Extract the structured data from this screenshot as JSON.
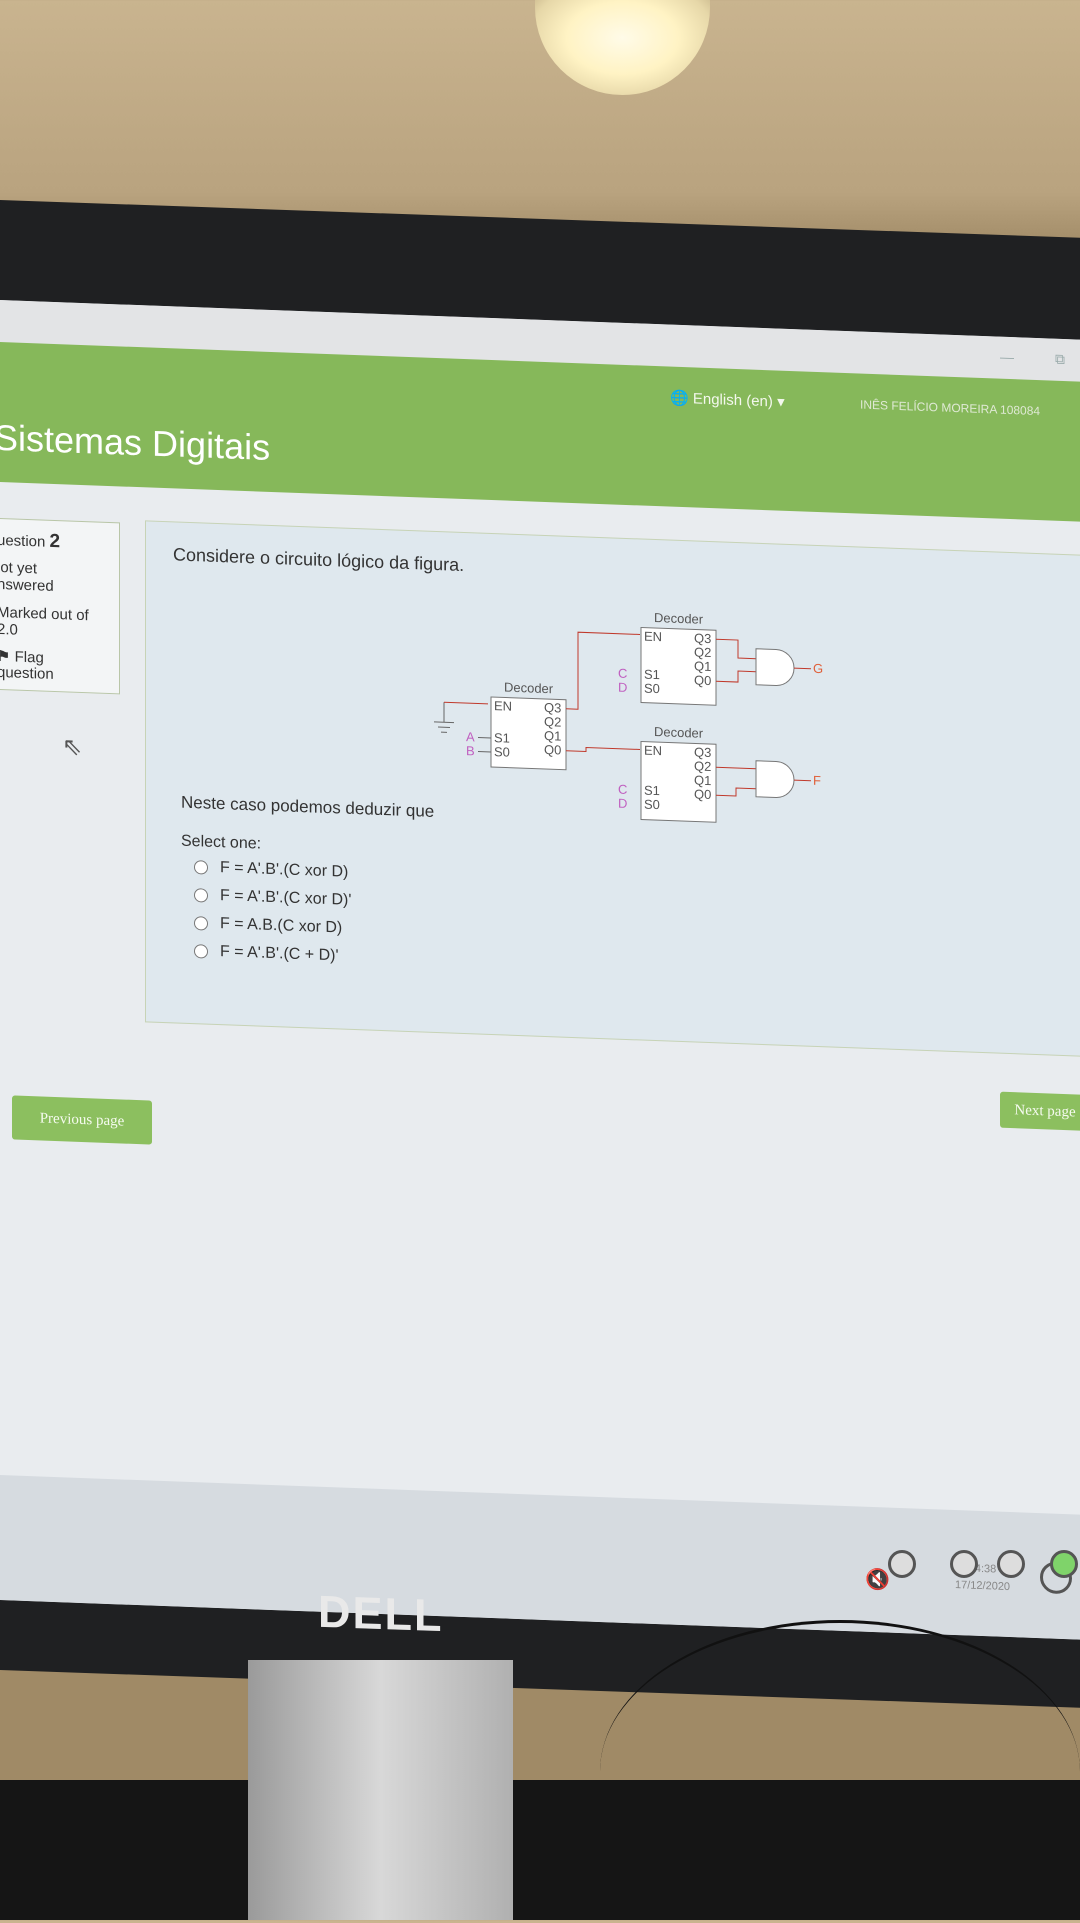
{
  "window": {
    "minimize_icon": "—",
    "restore_icon": "⧉"
  },
  "header": {
    "language": "English (en) ▾",
    "user_name": "INÊS FELÍCIO MOREIRA 108084",
    "site_title": "Sistemas Digitais"
  },
  "question_info": {
    "question_label": "uestion",
    "question_number": "2",
    "status_line1": "lot yet",
    "status_line2": "nswered",
    "marked_line1": "Marked out of",
    "marked_line2": "2.0",
    "flag_label": "Flag",
    "flag_line2": "question"
  },
  "question": {
    "text": "Considere o circuito lógico da figura.",
    "deduction": "Neste caso podemos deduzir que",
    "select_label": "Select one:",
    "options": [
      "F = A'.B'.(C xor D)",
      "F = A'.B'.(C xor D)'",
      "F = A.B.(C xor D)",
      "F = A'.B'.(C + D)'"
    ]
  },
  "circuit": {
    "decoder_label": "Decoder",
    "en": "EN",
    "s1": "S1",
    "s0": "S0",
    "q3": "Q3",
    "q2": "Q2",
    "q1": "Q1",
    "q0": "Q0",
    "in_a": "A",
    "in_b": "B",
    "in_c": "C",
    "in_d": "D",
    "out_g": "G",
    "out_f": "F",
    "colors": {
      "wire": "#c0392b",
      "input_label": "#c060c0",
      "output_label": "#e0603a"
    }
  },
  "nav": {
    "previous": "Previous page",
    "next": "Next page"
  },
  "taskbar": {
    "time": "14:38",
    "date": "17/12/2020",
    "mute_icon": "🔇"
  },
  "monitor": {
    "brand": "DELL"
  }
}
